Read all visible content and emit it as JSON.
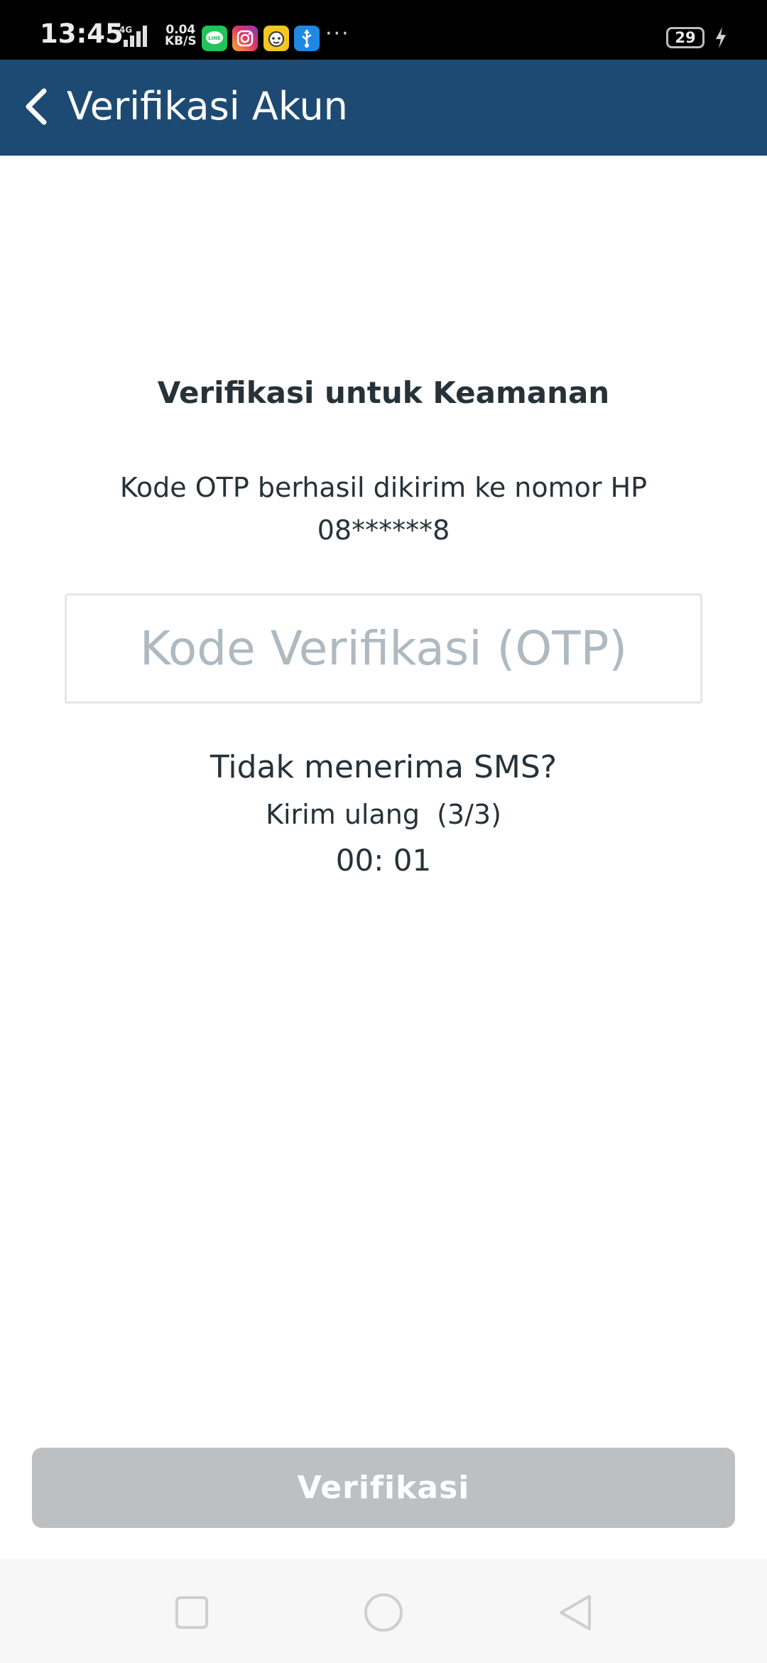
{
  "status_bar": {
    "time": "13:45",
    "network": "4G",
    "speed_value": "0.04",
    "speed_unit": "KB/S",
    "more": "···",
    "battery": "29",
    "app_icons": [
      "line-icon",
      "instagram-icon",
      "face-app-icon",
      "usb-icon"
    ]
  },
  "header": {
    "title": "Verifikasi Akun",
    "bg_color": "#1d4a72"
  },
  "main": {
    "heading": "Verifikasi untuk Keamanan",
    "info_line1": "Kode OTP berhasil dikirim ke nomor HP",
    "info_line2": "08******8",
    "otp_placeholder": "Kode Verifikasi (OTP)",
    "no_sms": "Tidak menerima SMS?",
    "resend": "Kirim ulang  (3/3)",
    "timer": "00: 01"
  },
  "footer": {
    "verify_label": "Verifikasi",
    "verify_color": "#bdc0c3"
  }
}
